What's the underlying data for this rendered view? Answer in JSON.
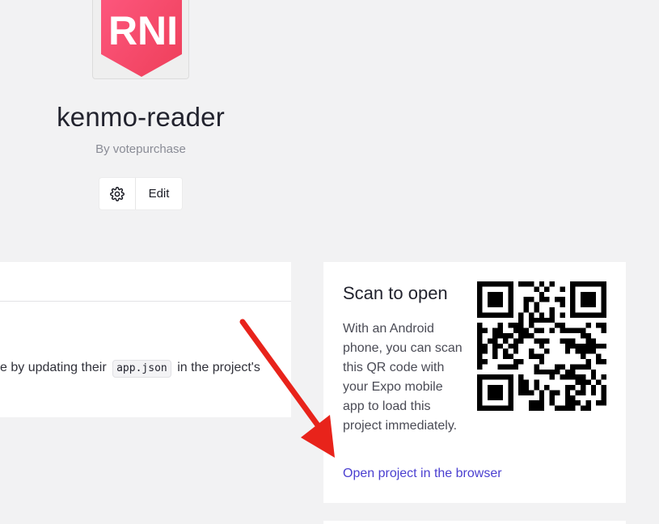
{
  "project": {
    "logo_text": "RNI",
    "name": "kenmo-reader",
    "owner": "By votepurchase"
  },
  "actions": {
    "settings_icon": "gear-icon",
    "edit_label": "Edit"
  },
  "config_panel": {
    "text_before": "e by updating their",
    "code": "app.json",
    "text_after": "in the project's"
  },
  "scan_panel": {
    "title": "Scan to open",
    "description": "With an Android phone, you can scan this QR code with your Expo mobile app to load this project immediately.",
    "link_label": "Open project in the browser"
  },
  "colors": {
    "logo_gradient_start": "#ff4d7d",
    "logo_gradient_end": "#f0455f",
    "link": "#4a3fd0",
    "annotation_arrow": "#e8231b"
  }
}
